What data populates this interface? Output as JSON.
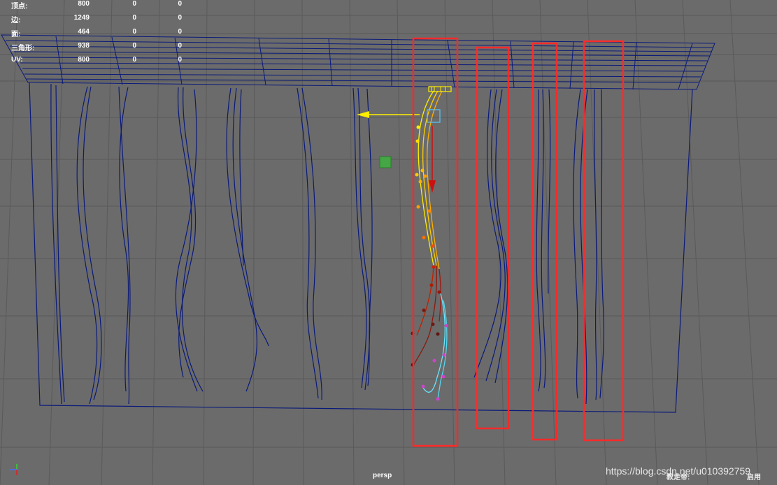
{
  "hud": {
    "rows": [
      {
        "label": "顶点:",
        "v1": "800",
        "v2": "0",
        "v3": "0"
      },
      {
        "label": "边:",
        "v1": "1249",
        "v2": "0",
        "v3": "0"
      },
      {
        "label": "面:",
        "v1": "464",
        "v2": "0",
        "v3": "0"
      },
      {
        "label": "三角形:",
        "v1": "938",
        "v2": "0",
        "v3": "0"
      },
      {
        "label": "UV:",
        "v1": "800",
        "v2": "0",
        "v3": "0"
      }
    ]
  },
  "viewport": {
    "camera": "persp",
    "background_color": "#6b6b6b",
    "grid_color": "#5c5c5c",
    "mesh_color": "#0a1a7a",
    "highlight_color": "#ff2a2a"
  },
  "status": {
    "left_text": "教走帝:",
    "right_text": "启用"
  },
  "watermark": "https://blog.csdn.net/u010392759"
}
